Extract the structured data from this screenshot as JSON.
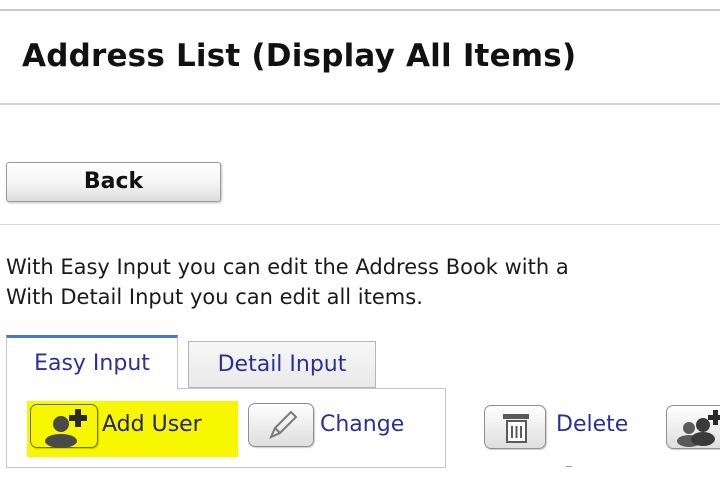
{
  "page": {
    "title": "Address List (Display All Items)"
  },
  "actions_top": {
    "back_label": "Back"
  },
  "description": {
    "line1": "With Easy Input you can edit the Address Book with a",
    "line2": "With Detail Input you can edit all items."
  },
  "tabs": [
    {
      "label": "Easy Input",
      "selected": true
    },
    {
      "label": "Detail Input",
      "selected": false
    }
  ],
  "toolbar": {
    "add_user_label": "Add User",
    "change_label": "Change",
    "delete_label": "Delete",
    "icons": [
      "add-user-icon",
      "pencil-icon",
      "trash-icon",
      "add-group-icon"
    ],
    "highlight_color": "#f7f700"
  },
  "colors": {
    "link_text": "#2b2f9a",
    "tab_accent": "#4a77c2",
    "title_text": "#111111"
  }
}
